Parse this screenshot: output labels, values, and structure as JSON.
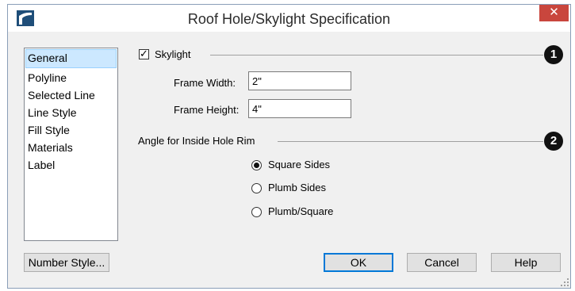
{
  "window": {
    "title": "Roof Hole/Skylight Specification",
    "close_glyph": "✕",
    "app_icon": "chief-architect-logo-icon"
  },
  "sidebar": {
    "items": [
      {
        "label": "General",
        "selected": true
      },
      {
        "label": "Polyline",
        "selected": false
      },
      {
        "label": "Selected Line",
        "selected": false
      },
      {
        "label": "Line Style",
        "selected": false
      },
      {
        "label": "Fill Style",
        "selected": false
      },
      {
        "label": "Materials",
        "selected": false
      },
      {
        "label": "Label",
        "selected": false
      }
    ]
  },
  "skylight": {
    "checkbox_label": "Skylight",
    "checked": true,
    "check_glyph": "✓",
    "callout": "1",
    "frame_width_label": "Frame Width:",
    "frame_width_value": "2\"",
    "frame_height_label": "Frame Height:",
    "frame_height_value": "4\""
  },
  "angle": {
    "group_label": "Angle for Inside Hole Rim",
    "callout": "2",
    "options": [
      {
        "label": "Square Sides",
        "selected": true
      },
      {
        "label": "Plumb Sides",
        "selected": false
      },
      {
        "label": "Plumb/Square",
        "selected": false
      }
    ]
  },
  "buttons": {
    "number_style": "Number Style...",
    "ok": "OK",
    "cancel": "Cancel",
    "help": "Help"
  },
  "colors": {
    "selection": "#cce8ff",
    "close_button": "#c9463d",
    "default_button_border": "#0078d7"
  }
}
